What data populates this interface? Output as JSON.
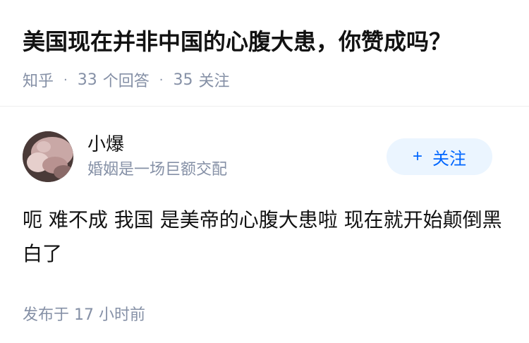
{
  "question": {
    "title": "美国现在并非中国的心腹大患，你赞成吗？",
    "source": "知乎",
    "answers_count": "33",
    "answers_label": "个回答",
    "follow_count": "35",
    "follow_label": "关注"
  },
  "answer": {
    "author_name": "小爆",
    "author_bio": "婚姻是一场巨额交配",
    "follow_button_label": "关注",
    "follow_button_icon": "plus-icon",
    "content": "呃 难不成 我国 是美帝的心腹大患啦 现在就开始颠倒黑白了",
    "time_prefix": "发布于",
    "time_value": "17 小时前"
  },
  "colors": {
    "title": "#121212",
    "meta_gray": "#8590a6",
    "accent_blue": "#0066ff",
    "follow_bg": "#ebf5ff"
  }
}
